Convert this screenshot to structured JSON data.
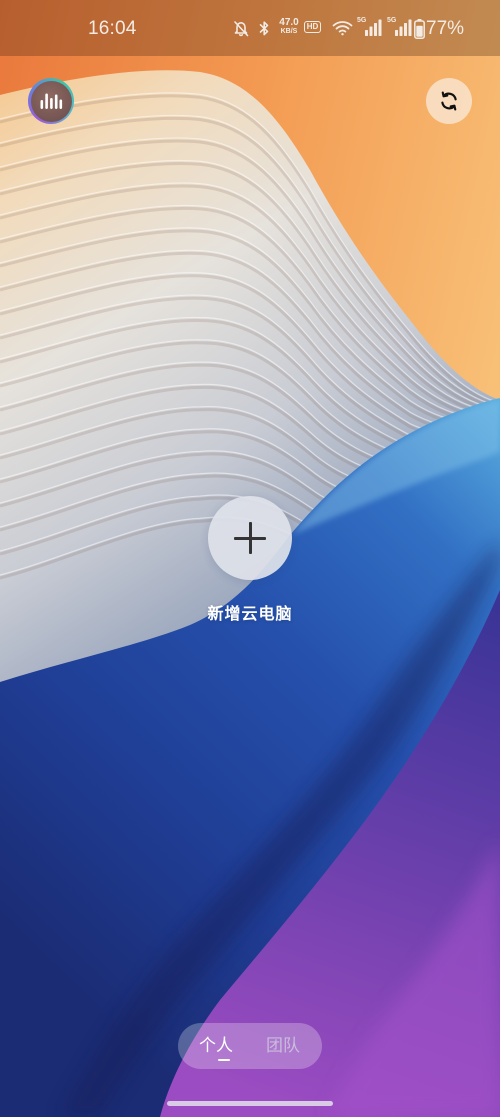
{
  "status_bar": {
    "time": "16:04",
    "net_speed_value": "47.0",
    "net_speed_unit": "KB/S",
    "hd_label": "HD",
    "sim1_label": "5G",
    "sim2_label": "5G",
    "battery_percent": "77%",
    "battery_level": 0.77,
    "icons": {
      "silent": "bell-off-icon",
      "bluetooth": "bluetooth-icon",
      "wifi": "wifi-icon",
      "signal": "signal-bars-icon",
      "battery": "battery-icon"
    }
  },
  "header": {
    "avatar_icon": "audio-bars-icon",
    "refresh_icon": "sync-icon"
  },
  "main": {
    "add_button_icon": "plus-icon",
    "add_label": "新增云电脑"
  },
  "tabs": [
    {
      "label": "个人",
      "selected": true
    },
    {
      "label": "团队",
      "selected": false
    }
  ],
  "colors": {
    "status_text": "#f3ebe4",
    "tab_selected": "#ffffff",
    "tab_unselected": "#c9bcdc",
    "add_button_bg": "#dfe2ea",
    "plus_icon": "#2a2a2a"
  }
}
